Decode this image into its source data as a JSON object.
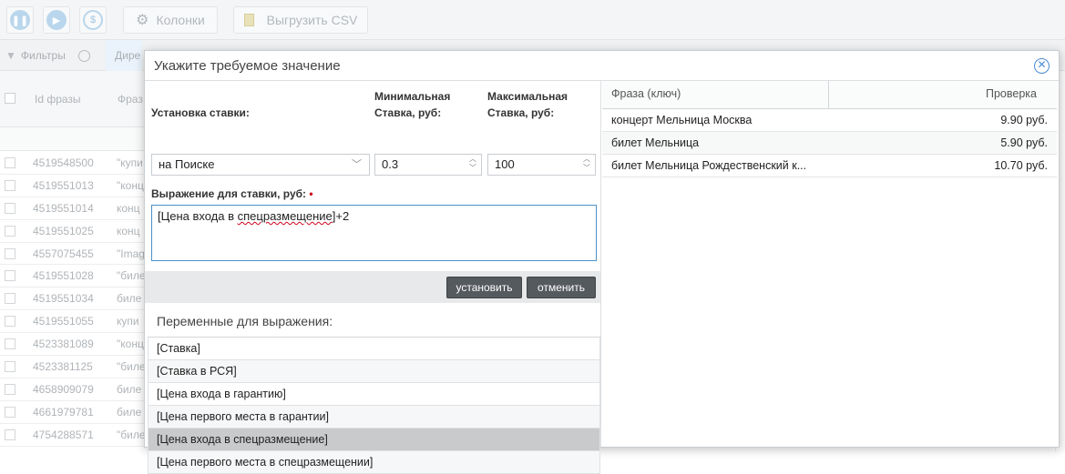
{
  "toolbar": {
    "pause_icon": "pause-icon",
    "play_icon": "play-icon",
    "dollar_icon": "dollar-icon",
    "columns_label": "Колонки",
    "export_label": "Выгрузить CSV"
  },
  "filterbar": {
    "filters_label": "Фильтры",
    "direct_tab": "Дире"
  },
  "grid": {
    "id_header": "Id фразы",
    "phrase_header": "Фраз",
    "rows": [
      {
        "id": "4519548500",
        "ph": "\"купи"
      },
      {
        "id": "4519551013",
        "ph": "\"конц"
      },
      {
        "id": "4519551014",
        "ph": "конц"
      },
      {
        "id": "4519551025",
        "ph": "конц"
      },
      {
        "id": "4557075455",
        "ph": "\"Imag"
      },
      {
        "id": "4519551028",
        "ph": "\"биле"
      },
      {
        "id": "4519551034",
        "ph": "биле"
      },
      {
        "id": "4519551055",
        "ph": "купи"
      },
      {
        "id": "4523381089",
        "ph": "\"конц"
      },
      {
        "id": "4523381125",
        "ph": "\"биле"
      },
      {
        "id": "4658909079",
        "ph": "биле"
      },
      {
        "id": "4661979781",
        "ph": "биле"
      },
      {
        "id": "4754288571",
        "ph": "\"биле"
      }
    ]
  },
  "modal": {
    "title": "Укажите требуемое значение",
    "bid_setting_label": "Установка ставки:",
    "bid_setting_value": "на Поиске",
    "min_bid_label_1": "Минимальная",
    "min_bid_label_2": "Ставка, руб:",
    "min_bid_value": "0.3",
    "max_bid_label_1": "Максимальная",
    "max_bid_label_2": "Ставка, руб:",
    "max_bid_value": "100",
    "expr_label": "Выражение для ставки, руб:",
    "expr_prefix": "[Цена входа в ",
    "expr_misspelled": "спецразмещение",
    "expr_suffix": "]+2",
    "set_button": "установить",
    "cancel_button": "отменить",
    "vars_title": "Переменные для выражения:",
    "variables": [
      "[Ставка]",
      "[Ставка в РСЯ]",
      "[Цена входа в гарантию]",
      "[Цена первого места в гарантии]",
      "[Цена входа в спецразмещение]",
      "[Цена первого места в спецразмещении]"
    ],
    "selected_variable_index": 4,
    "preview": {
      "col_phrase": "Фраза (ключ)",
      "col_check": "Проверка",
      "rows": [
        {
          "phrase": "концерт Мельница Москва",
          "value": "9.90 руб."
        },
        {
          "phrase": "билет Мельница",
          "value": "5.90 руб."
        },
        {
          "phrase": "билет Мельница Рождественский к...",
          "value": "10.70 руб."
        }
      ]
    }
  }
}
